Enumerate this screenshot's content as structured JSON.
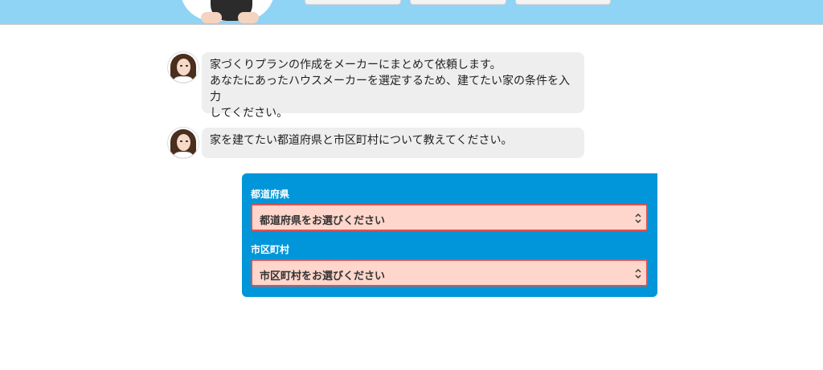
{
  "chat": [
    {
      "lines": [
        "家づくりプランの作成をメーカーにまとめて依頼します。",
        "あなたにあったハウスメーカーを選定するため、建てたい家の条件を入力",
        "してください。"
      ]
    },
    {
      "lines": [
        "家を建てたい都道府県と市区町村について教えてください。"
      ]
    }
  ],
  "form": {
    "prefecture_label": "都道府県",
    "prefecture_placeholder": "都道府県をお選びください",
    "city_label": "市区町村",
    "city_placeholder": "市区町村をお選びください"
  },
  "colors": {
    "banner": "#8fd3f5",
    "panel": "#0096d9",
    "select_bg": "#ffd6cb",
    "select_border": "#de5252",
    "bubble": "#eeeeee"
  }
}
